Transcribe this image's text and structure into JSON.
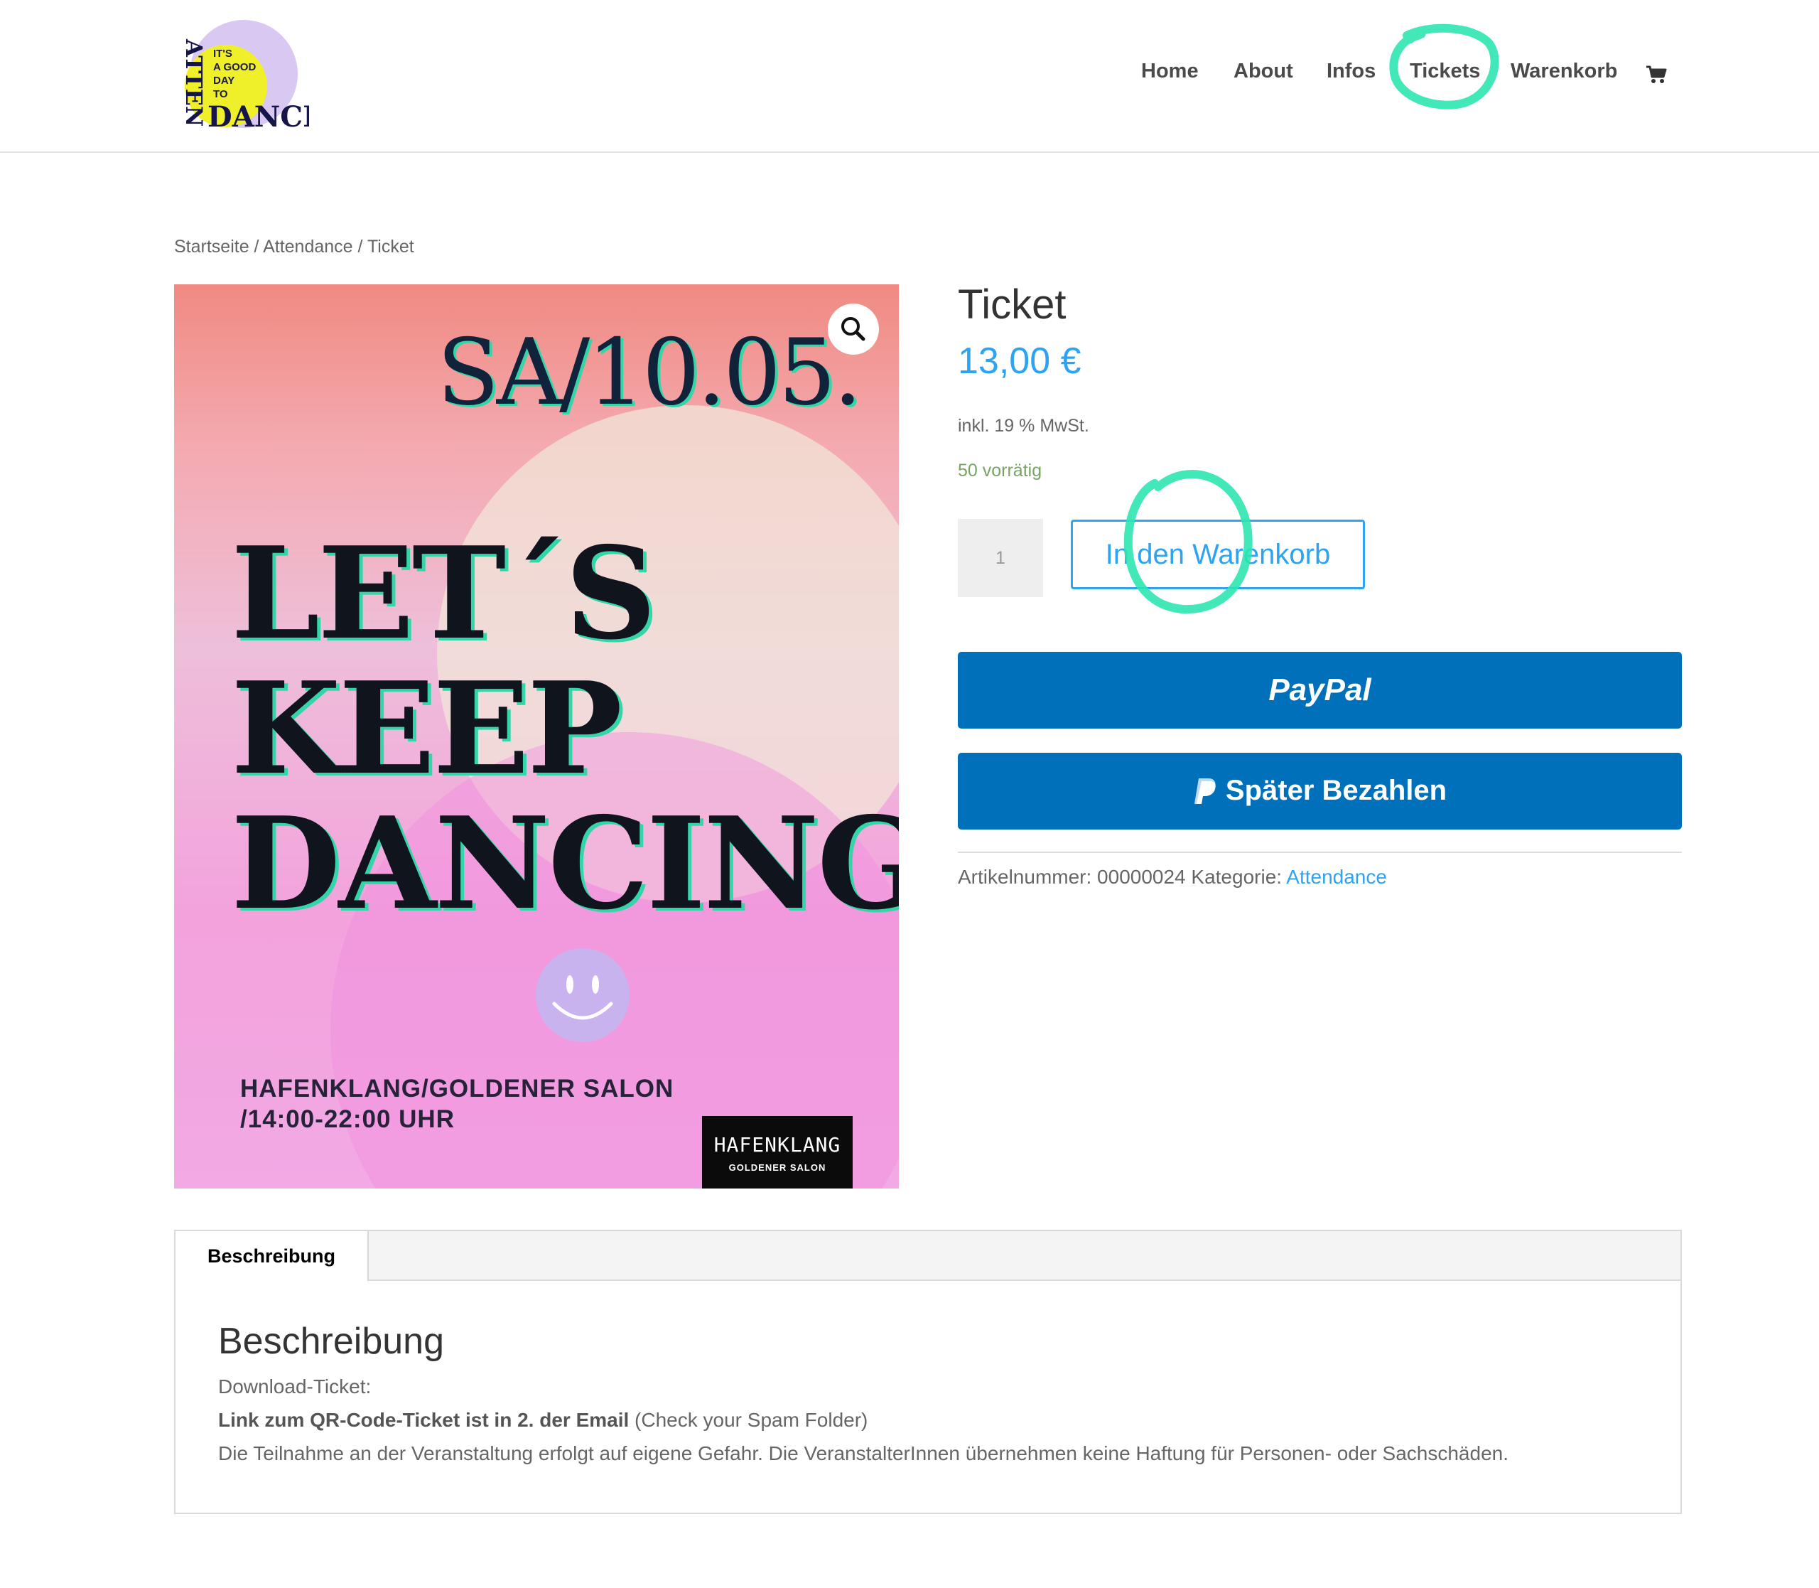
{
  "header": {
    "logo_text": [
      "IT'S",
      "A GOOD",
      "DAY",
      "TO",
      "DANCE"
    ],
    "logo_vertical_text": "ATTEN",
    "nav": [
      {
        "label": "Home"
      },
      {
        "label": "About"
      },
      {
        "label": "Infos"
      },
      {
        "label": "Tickets"
      },
      {
        "label": "Warenkorb"
      }
    ],
    "cart_icon": "shopping-cart-icon"
  },
  "breadcrumb": {
    "items": [
      "Startseite",
      "Attendance",
      "Ticket"
    ],
    "separator": " / "
  },
  "poster": {
    "date": "SA/10.05.",
    "headline": [
      "LET´S",
      "KEEP",
      "DANCING"
    ],
    "venue": [
      "HAFENKLANG/GOLDENER SALON",
      "/14:00-22:00 UHR"
    ],
    "logo_main": "HAFENKLANG",
    "logo_sub": "GOLDENER SALON",
    "zoom_icon": "magnifier-icon"
  },
  "product": {
    "title": "Ticket",
    "price": "13,00 €",
    "tax_note": "inkl. 19 % MwSt.",
    "stock": "50 vorrätig",
    "quantity": "1",
    "add_to_cart": "In den Warenkorb",
    "paypal_label": "PayPal",
    "pay_later_label": "Später Bezahlen",
    "sku_label": "Artikelnummer:",
    "sku": "00000024",
    "category_label": "Kategorie:",
    "category": "Attendance"
  },
  "tabs": {
    "items": [
      {
        "label": "Beschreibung"
      }
    ],
    "content_title": "Beschreibung",
    "line1": "Download-Ticket:",
    "line2_bold": "Link zum QR-Code-Ticket ist in 2. der Email",
    "line2_rest": " (Check your Spam Folder)",
    "line3": "Die Teilnahme an der Veranstaltung erfolgt auf eigene Gefahr. Die VeranstalterInnen übernehmen keine Haftung für Personen- oder Sachschäden."
  },
  "colors": {
    "accent": "#2ea3f2",
    "paypal": "#0070ba",
    "stock": "#77a464",
    "highlight": "#2ee6b0"
  }
}
